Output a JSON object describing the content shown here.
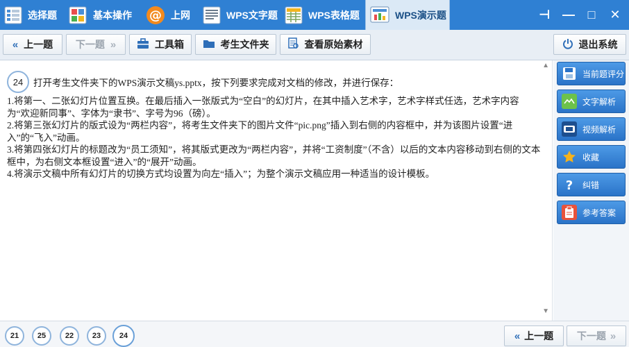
{
  "top_tabs": [
    {
      "label": "选择题",
      "icon": "choice-icon"
    },
    {
      "label": "基本操作",
      "icon": "basic-ops-icon"
    },
    {
      "label": "上网",
      "icon": "internet-icon"
    },
    {
      "label": "WPS文字题",
      "icon": "wps-writer-icon"
    },
    {
      "label": "WPS表格题",
      "icon": "wps-spreadsheet-icon"
    },
    {
      "label": "WPS演示题",
      "icon": "wps-presentation-icon",
      "active": true
    }
  ],
  "window_controls": {
    "pin": "⊣",
    "minimize": "—",
    "maximize": "□",
    "close": "✕"
  },
  "toolbar": {
    "prev_label": "上一题",
    "next_label": "下一题",
    "toolbox_label": "工具箱",
    "student_folder_label": "考生文件夹",
    "view_material_label": "查看原始素材",
    "exit_label": "退出系统"
  },
  "question": {
    "number": "24",
    "title": "打开考生文件夹下的WPS演示文稿ys.pptx，按下列要求完成对文档的修改，并进行保存：",
    "items": [
      "1.将第一、二张幻灯片位置互换。在最后插入一张版式为“空白”的幻灯片，在其中插入艺术字，艺术字样式任选，艺术字内容为“欢迎新同事”、字体为“隶书”、字号为96（磅）。",
      "2.将第三张幻灯片的版式设为“两栏内容”，将考生文件夹下的图片文件“pic.png”插入到右侧的内容框中，并为该图片设置“进入”的“飞入”动画。",
      "3.将第四张幻灯片的标题改为“员工须知”，将其版式更改为“两栏内容”，并将“工资制度”（不含）以后的文本内容移动到右侧的文本框中，为右侧文本框设置“进入”的“展开”动画。",
      "4.将演示文稿中所有幻灯片的切换方式均设置为向左“插入”；为整个演示文稿应用一种适当的设计模板。"
    ]
  },
  "sidebar": {
    "items": [
      {
        "label": "当前题评分",
        "icon": "save-icon"
      },
      {
        "label": "文字解析",
        "icon": "text-analysis-icon"
      },
      {
        "label": "视频解析",
        "icon": "video-icon"
      },
      {
        "label": "收藏",
        "icon": "star-icon"
      },
      {
        "label": "纠错",
        "icon": "question-icon"
      },
      {
        "label": "参考答案",
        "icon": "clipboard-icon"
      }
    ]
  },
  "bottom": {
    "question_numbers": [
      "21",
      "25",
      "22",
      "23",
      "24"
    ],
    "current": "24",
    "prev_label": "上一题",
    "next_label": "下一题"
  },
  "colors": {
    "title_bar": "#2f80d3",
    "active_tab": "#dbe9f6",
    "sidebar_button": "#3b86d8",
    "circle_border": "#8fb4dc"
  }
}
